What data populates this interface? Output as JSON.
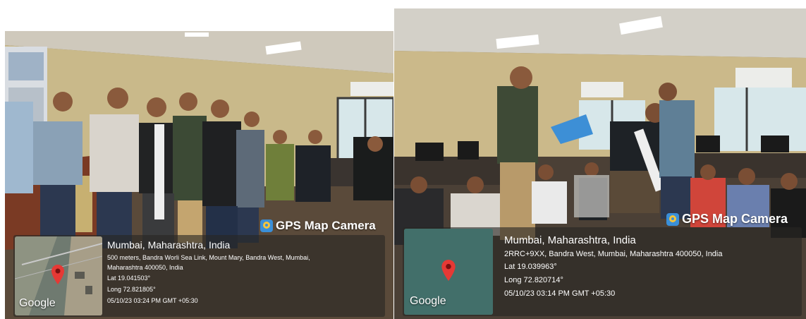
{
  "photos": [
    {
      "badge": "GPS Map Camera",
      "map_logo": "Google",
      "place": "Mumbai, Maharashtra, India",
      "address_line1": "500 meters, Bandra Worli Sea Link, Mount Mary, Bandra West, Mumbai,",
      "address_line2": "Maharashtra 400050, India",
      "lat": "Lat 19.041503°",
      "long": "Long 72.821805°",
      "datetime": "05/10/23 03:24 PM GMT +05:30"
    },
    {
      "badge": "GPS Map Camera",
      "map_logo": "Google",
      "place": "Mumbai, Maharashtra, India",
      "address_line1": "2RRC+9XX, Bandra West, Mumbai, Maharashtra 400050, India",
      "lat": "Lat 19.039963°",
      "long": "Long 72.820714°",
      "datetime": "05/10/23 03:14 PM GMT +05:30"
    }
  ],
  "colors": {
    "pin": "#e53935",
    "overlay": "#2a2826",
    "badge_icon": "#3a8fd8"
  },
  "icons": [
    "gps-map-camera-icon",
    "map-pin-icon"
  ]
}
